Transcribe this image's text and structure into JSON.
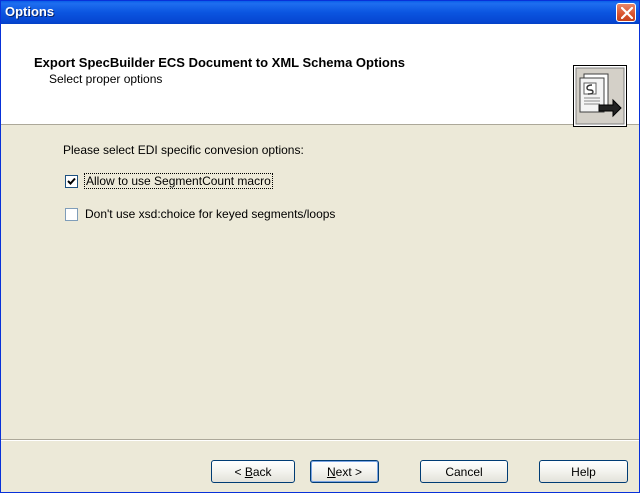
{
  "window": {
    "title": "Options"
  },
  "header": {
    "title": "Export SpecBuilder ECS Document to XML Schema Options",
    "subtitle": "Select proper options"
  },
  "content": {
    "prompt": "Please select EDI specific convesion options:",
    "options": [
      {
        "label": "Allow to use SegmentCount macro",
        "checked": true
      },
      {
        "label": "Don't use xsd:choice for keyed segments/loops",
        "checked": false
      }
    ]
  },
  "buttons": {
    "back": {
      "prefix": "< ",
      "mnemonic": "B",
      "rest": "ack"
    },
    "next": {
      "mnemonic": "N",
      "rest": "ext >"
    },
    "cancel": "Cancel",
    "help": "Help"
  },
  "colors": {
    "title_bar": "#0A5FE8",
    "dialog_bg": "#ECE9D8",
    "header_bg": "#FFFFFF"
  },
  "icons": {
    "close": "close-icon",
    "header": "export-document-icon",
    "check": "check-icon"
  }
}
